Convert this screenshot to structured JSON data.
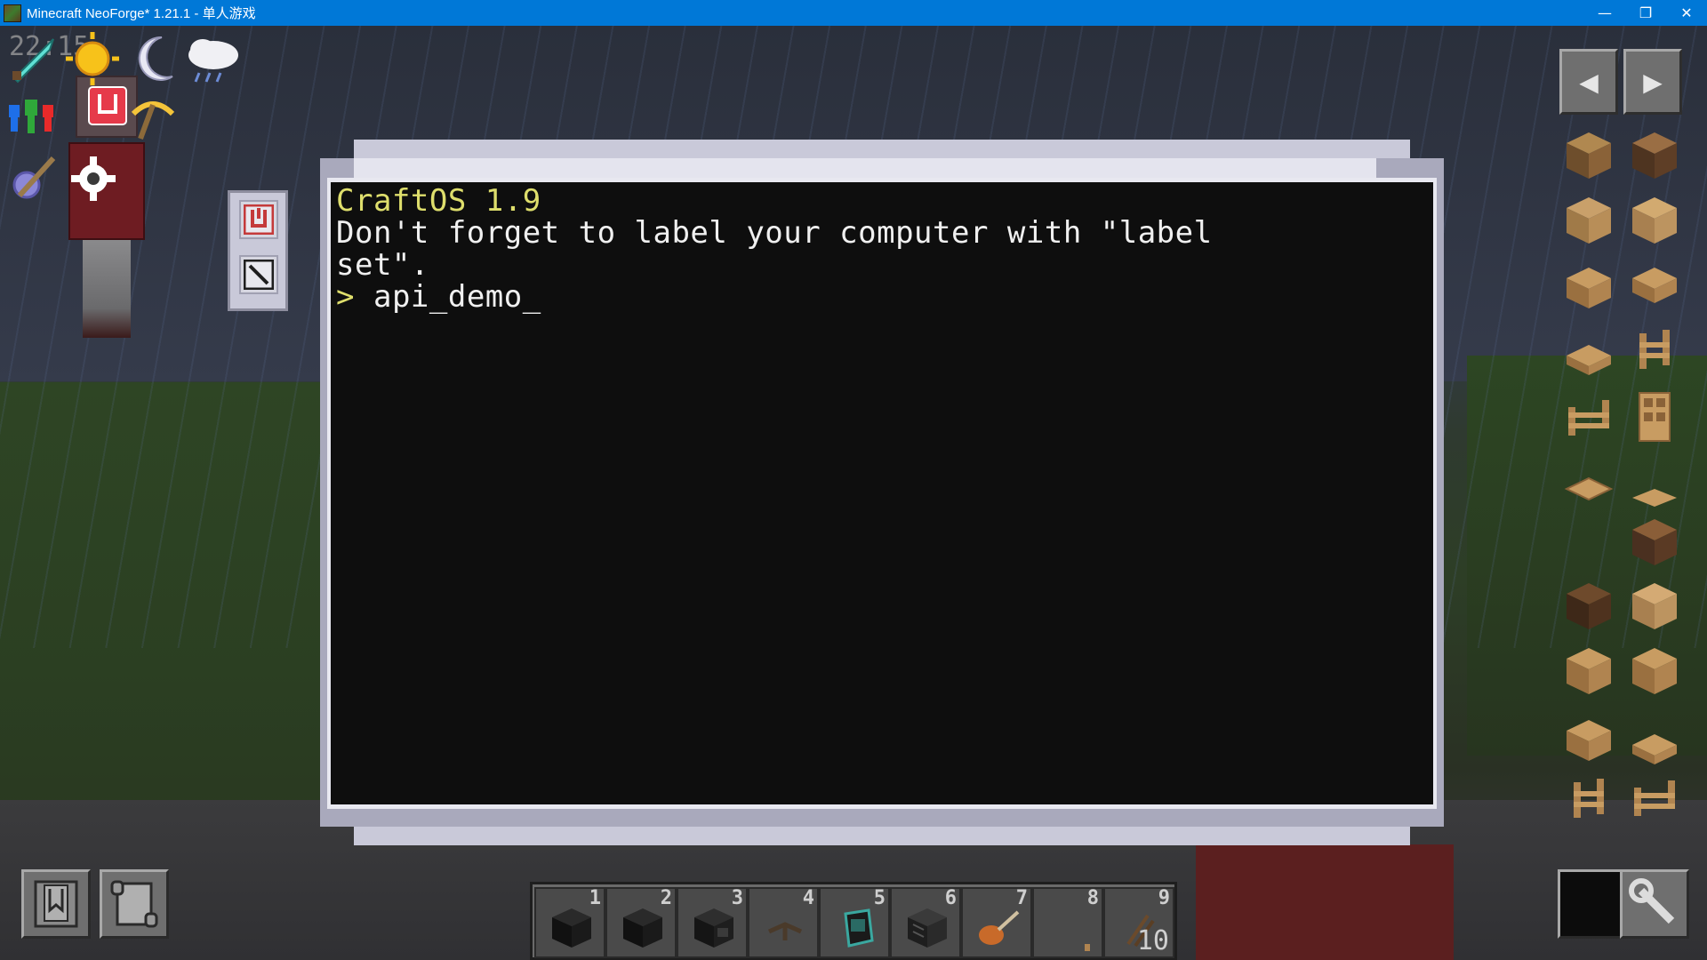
{
  "window": {
    "title": "Minecraft NeoForge* 1.21.1 - 单人游戏",
    "minimize": "—",
    "restore": "❐",
    "close": "✕"
  },
  "hud": {
    "faded_text": "22:15"
  },
  "terminal": {
    "lines": [
      {
        "text": "CraftOS 1.9",
        "color": "#dede6c"
      },
      {
        "text": "Don't forget to label your computer with \"label",
        "color": "#f0f0f0"
      },
      {
        "text": "set\".",
        "color": "#f0f0f0"
      }
    ],
    "prompt": ">",
    "command": "api_demo_"
  },
  "side_panel": {
    "power_icon": "power-icon",
    "terminate_icon": "terminate-icon"
  },
  "item_panel": {
    "prev_label": "◀",
    "next_label": "▶"
  },
  "hotbar": {
    "slots": [
      {
        "num": "1",
        "item": "computer",
        "count": ""
      },
      {
        "num": "2",
        "item": "computer",
        "count": ""
      },
      {
        "num": "3",
        "item": "advanced-computer",
        "count": ""
      },
      {
        "num": "4",
        "item": "cable",
        "count": ""
      },
      {
        "num": "5",
        "item": "pocket-computer",
        "count": ""
      },
      {
        "num": "6",
        "item": "monitor",
        "count": ""
      },
      {
        "num": "7",
        "item": "guitar",
        "count": ""
      },
      {
        "num": "8",
        "item": "frame",
        "count": ""
      },
      {
        "num": "9",
        "item": "sticks",
        "count": "10"
      }
    ]
  },
  "colors": {
    "titlebar": "#0078d7",
    "terminal_bg": "#0e0e0e",
    "terminal_yellow": "#dede6c",
    "gui_frame": "#c9c9d9"
  }
}
